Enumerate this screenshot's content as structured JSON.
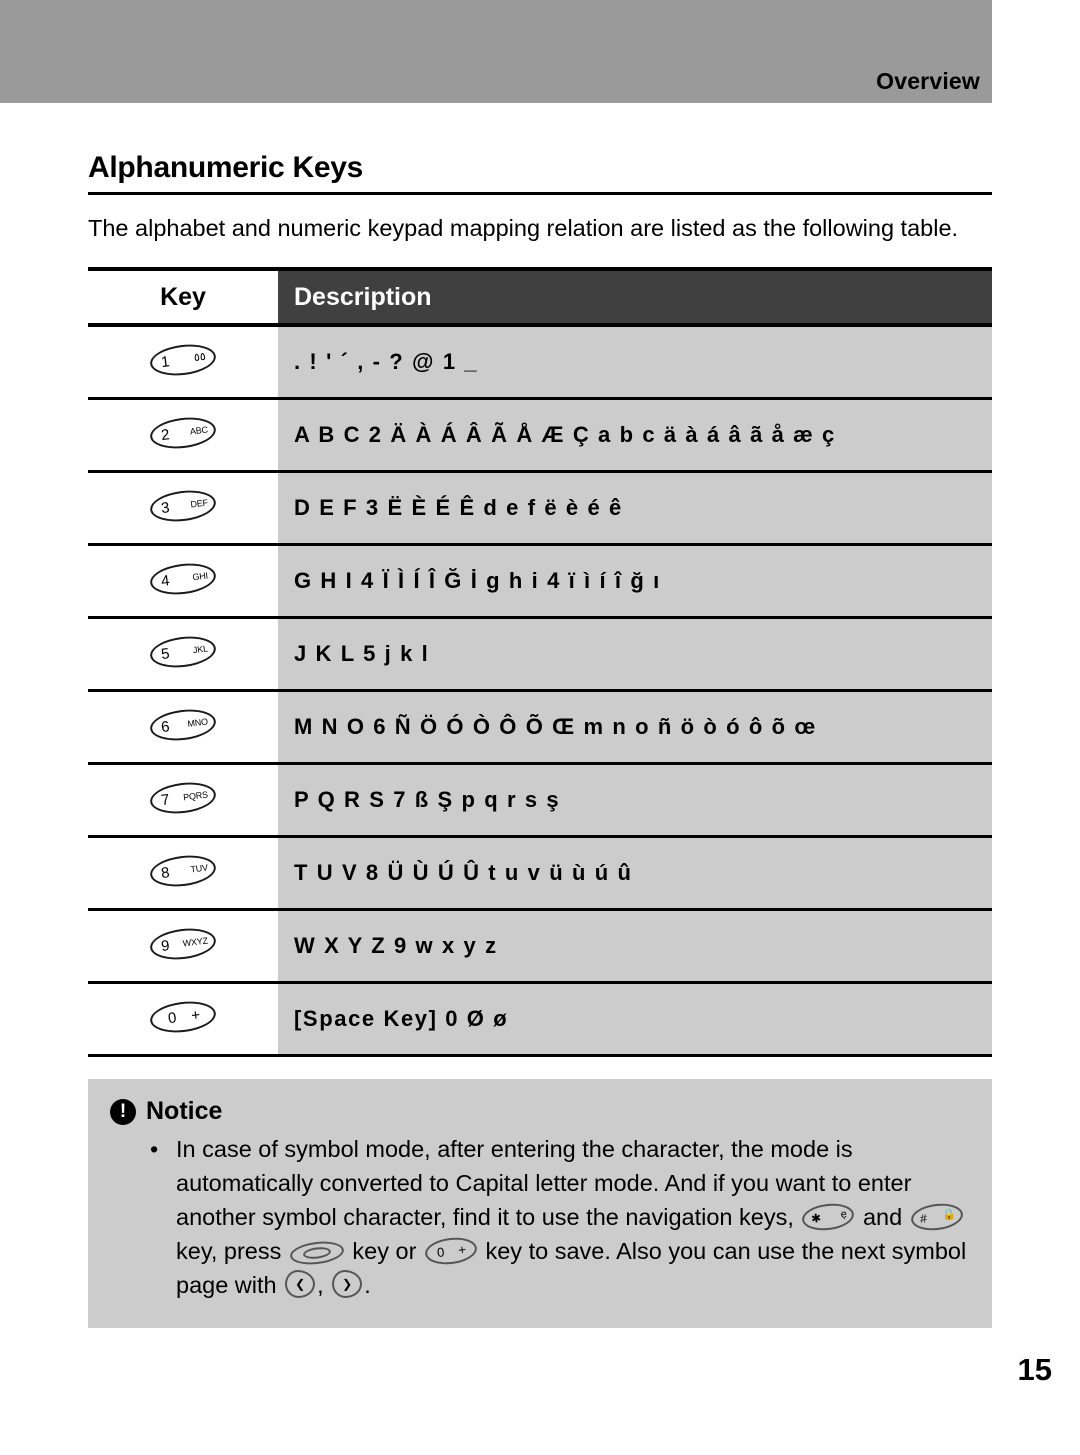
{
  "header": {
    "running_title": "Overview"
  },
  "section": {
    "title": "Alphanumeric Keys",
    "intro": "The alphabet and numeric keypad mapping relation are listed as the following table."
  },
  "table": {
    "columns": {
      "key": "Key",
      "description": "Description"
    },
    "rows": [
      {
        "key_num": "1",
        "key_sub": "٥٥",
        "key_name": "key-1",
        "description": ". ! ' ´ , - ? @ 1 _"
      },
      {
        "key_num": "2",
        "key_sub": "ABC",
        "key_name": "key-2-abc",
        "description": "A B C 2 Ä À Á Â Ã Å Æ Ç a b c ä à á â ã å æ ç"
      },
      {
        "key_num": "3",
        "key_sub": "DEF",
        "key_name": "key-3-def",
        "description": "D E F 3 Ë È É Ê d e f ë è é ê"
      },
      {
        "key_num": "4",
        "key_sub": "GHI",
        "key_name": "key-4-ghi",
        "description": "G H I 4 Ï Ì Í Î Ğ İ g h i 4 ï ì í î ğ ı"
      },
      {
        "key_num": "5",
        "key_sub": "JKL",
        "key_name": "key-5-jkl",
        "description": "J K L 5 j k l"
      },
      {
        "key_num": "6",
        "key_sub": "MNO",
        "key_name": "key-6-mno",
        "description": "M N O 6 Ñ Ö Ó Ò Ô Õ Œ m n o ñ ö ò ó ô õ œ"
      },
      {
        "key_num": "7",
        "key_sub": "PQRS",
        "key_name": "key-7-pqrs",
        "description": "P Q R S 7 ß Ş p q r s ş"
      },
      {
        "key_num": "8",
        "key_sub": "TUV",
        "key_name": "key-8-tuv",
        "description": "T U V 8 Ü Ù Ú Û t u v ü ù ú û"
      },
      {
        "key_num": "9",
        "key_sub": "WXYZ",
        "key_name": "key-9-wxyz",
        "description": "W X Y Z 9 w x y z"
      },
      {
        "key_num": "0",
        "key_sub": "+",
        "key_name": "key-0-plus",
        "description": "[Space Key] 0 Ø ø"
      }
    ]
  },
  "notice": {
    "title": "Notice",
    "icon": "exclamation-circle-icon",
    "text_part_1": "In case of symbol mode, after entering the character, the mode is automatically converted to Capital letter mode. And if you want to enter another symbol character, find it to use the navigation keys,",
    "text_part_2": "and",
    "text_part_3": "key, press",
    "text_part_4": "key or",
    "text_part_5": "key to save. Also you can use the next symbol page with",
    "text_part_6": ",",
    "text_part_7": ".",
    "inline_keys": {
      "star": "✱",
      "star_sub": "ẹ",
      "hash": "#",
      "hash_sub": "🔒",
      "zero": "0",
      "zero_sub": "+",
      "nav_left": "❮",
      "nav_right": "❯"
    }
  },
  "folio": "15",
  "colors": {
    "header_band": "#9a9a9a",
    "table_header_desc": "#404040",
    "table_body_desc": "#cccccc",
    "notice_box": "#cccccc"
  }
}
